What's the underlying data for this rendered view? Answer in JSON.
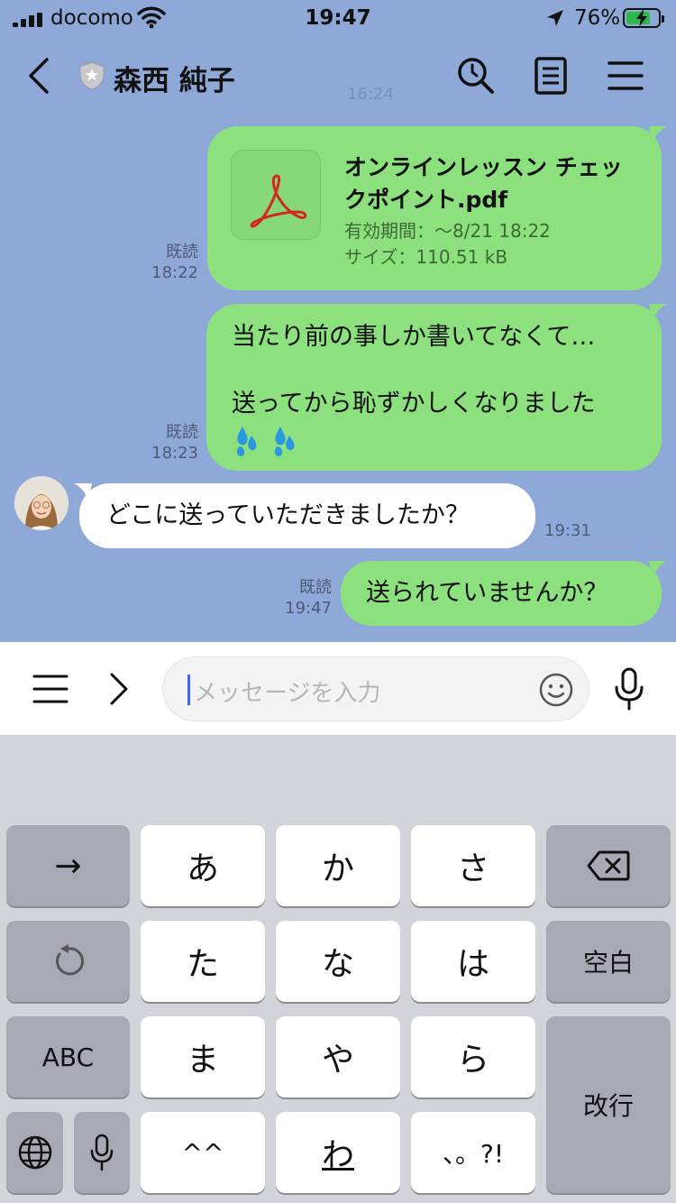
{
  "status_bar": {
    "carrier": "docomo",
    "time": "19:47",
    "battery_percent": "76%",
    "battery_level": 0.76
  },
  "header": {
    "title": "森西 純子",
    "faded_time": "16:24"
  },
  "messages": [
    {
      "type": "file",
      "side": "right",
      "file_name": "オンラインレッスン チェックポイント.pdf",
      "expiry": "有効期間：〜8/21 18:22",
      "size": "サイズ：110.51 kB",
      "read_label": "既読",
      "time": "18:22"
    },
    {
      "type": "text",
      "side": "right",
      "line1": "当たり前の事しか書いてなくて…",
      "line2": "送ってから恥ずかしくなりました",
      "read_label": "既読",
      "time": "18:23"
    },
    {
      "type": "text",
      "side": "left",
      "text": "どこに送っていただきましたか？",
      "time": "19:31"
    },
    {
      "type": "text",
      "side": "right",
      "text": "送られていませんか？",
      "read_label": "既読",
      "time": "19:47"
    }
  ],
  "input": {
    "placeholder": "メッセージを入力"
  },
  "keyboard": {
    "row1": [
      "→",
      "あ",
      "か",
      "さ",
      "delete"
    ],
    "row2": [
      "undo",
      "た",
      "な",
      "は",
      "空白"
    ],
    "row3": [
      "ABC",
      "ま",
      "や",
      "ら",
      "改行"
    ],
    "row4": [
      "globe",
      "mic",
      "^^",
      "わ",
      "、。?!"
    ]
  },
  "colors": {
    "chat_background": "#8ea8d8",
    "green_bubble": "#8de07e",
    "white_bubble": "#ffffff",
    "keyboard_background": "#d3d3da",
    "caret": "#3d66e8",
    "battery_fill": "#2db84a"
  }
}
